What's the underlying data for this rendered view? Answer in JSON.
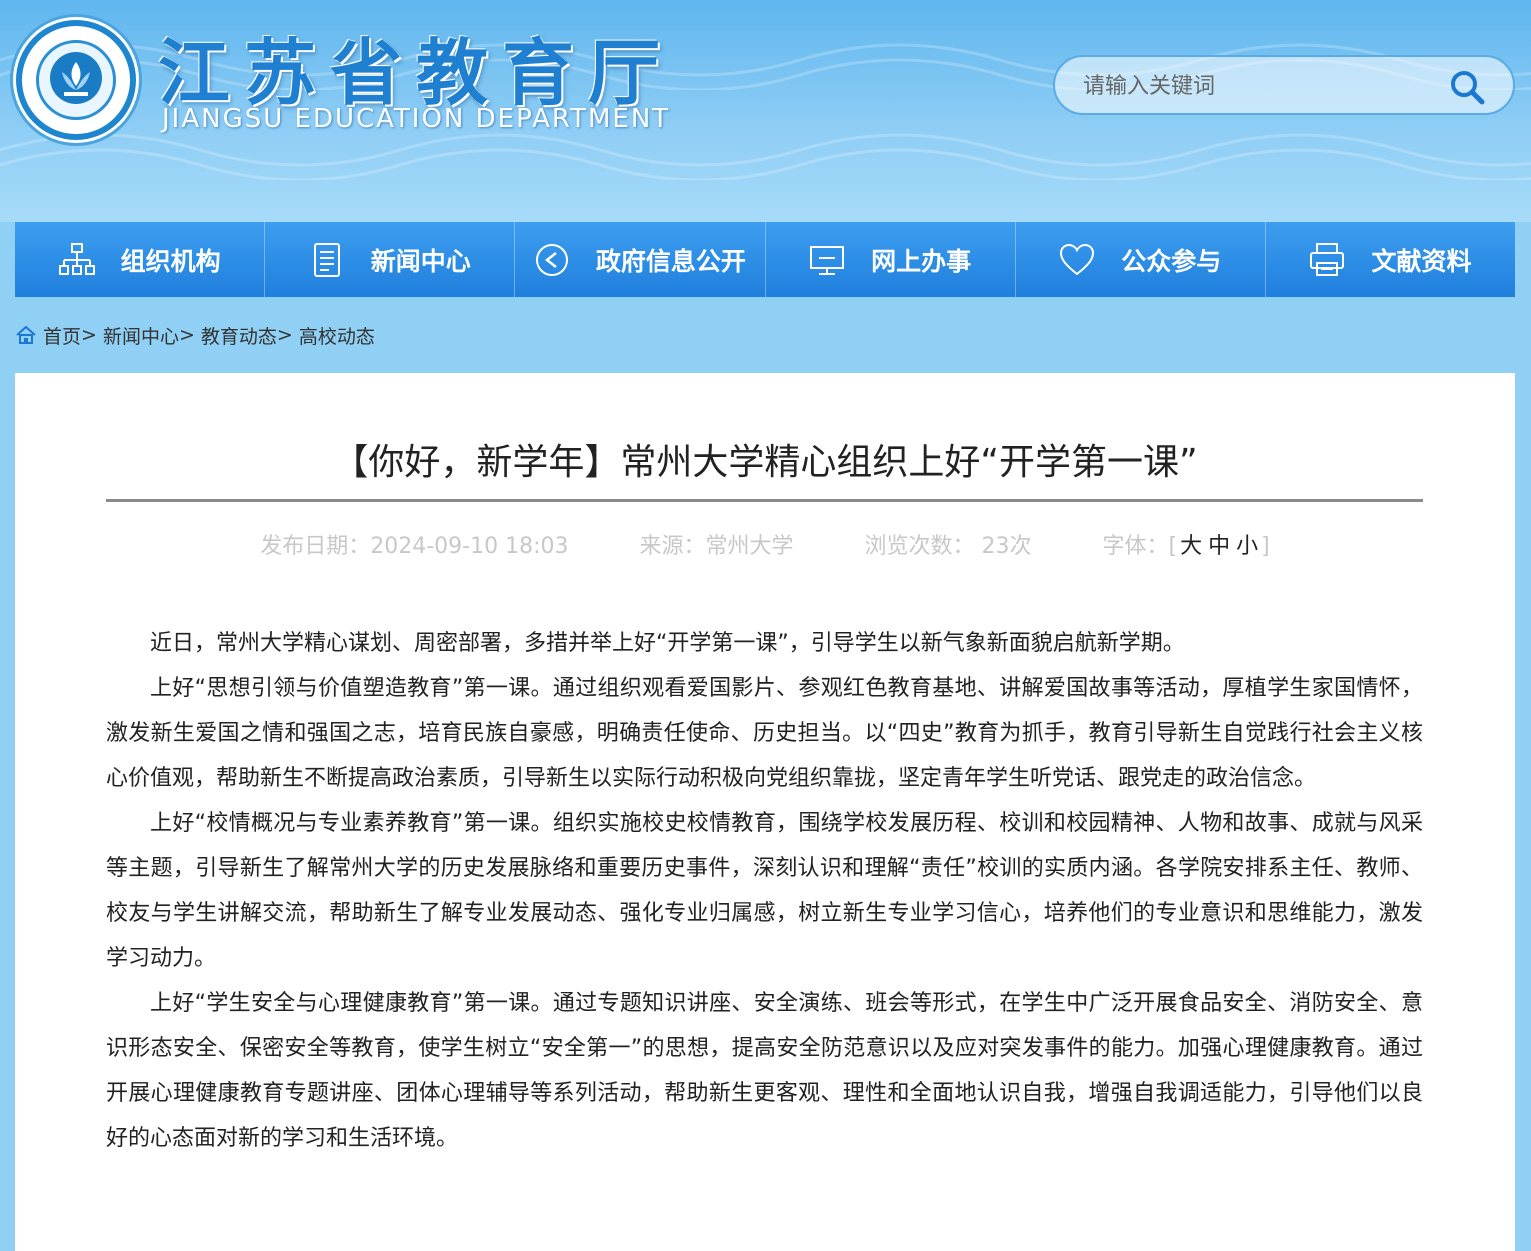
{
  "header": {
    "title": "江苏省教育厅",
    "subtitle": "JIANGSU EDUCATION DEPARTMENT",
    "search_placeholder": "请输入关键词"
  },
  "nav": {
    "items": [
      {
        "label": "组织机构",
        "icon": "org-chart-icon"
      },
      {
        "label": "新闻中心",
        "icon": "document-icon"
      },
      {
        "label": "政府信息公开",
        "icon": "play-circle-icon"
      },
      {
        "label": "网上办事",
        "icon": "monitor-icon"
      },
      {
        "label": "公众参与",
        "icon": "heart-icon"
      },
      {
        "label": "文献资料",
        "icon": "printer-icon"
      }
    ]
  },
  "breadcrumb": {
    "items": [
      "首页",
      "新闻中心",
      "教育动态",
      "高校动态"
    ],
    "separator": ">"
  },
  "article": {
    "title": "【你好，新学年】常州大学精心组织上好“开学第一课”",
    "date_label": "发布日期：2024-09-10 18:03",
    "source_label": "来源：常州大学",
    "views_label": "浏览次数：  23次",
    "font_label": "字体：",
    "font_open": "[",
    "font_large": "大",
    "font_medium": "中",
    "font_small": "小",
    "font_close": "]",
    "paragraphs": [
      "近日，常州大学精心谋划、周密部署，多措并举上好“开学第一课”，引导学生以新气象新面貌启航新学期。",
      "上好“思想引领与价值塑造教育”第一课。通过组织观看爱国影片、参观红色教育基地、讲解爱国故事等活动，厚植学生家国情怀，激发新生爱国之情和强国之志，培育民族自豪感，明确责任使命、历史担当。以“四史”教育为抓手，教育引导新生自觉践行社会主义核心价值观，帮助新生不断提高政治素质，引导新生以实际行动积极向党组织靠拢，坚定青年学生听党话、跟党走的政治信念。",
      "上好“校情概况与专业素养教育”第一课。组织实施校史校情教育，围绕学校发展历程、校训和校园精神、人物和故事、成就与风采等主题，引导新生了解常州大学的历史发展脉络和重要历史事件，深刻认识和理解“责任”校训的实质内涵。各学院安排系主任、教师、校友与学生讲解交流，帮助新生了解专业发展动态、强化专业归属感，树立新生专业学习信心，培养他们的专业意识和思维能力，激发学习动力。",
      "上好“学生安全与心理健康教育”第一课。通过专题知识讲座、安全演练、班会等形式，在学生中广泛开展食品安全、消防安全、意识形态安全、保密安全等教育，使学生树立“安全第一”的思想，提高安全防范意识以及应对突发事件的能力。加强心理健康教育。通过开展心理健康教育专题讲座、团体心理辅导等系列活动，帮助新生更客观、理性和全面地认识自我，增强自我调适能力，引导他们以良好的心态面对新的学习和生活环境。"
    ]
  },
  "colors": {
    "nav_bg": "#2a8ae6",
    "header_bg": "#6dbdf0",
    "page_bg": "#8fd0f4",
    "title_text": "#1f7fd0"
  }
}
